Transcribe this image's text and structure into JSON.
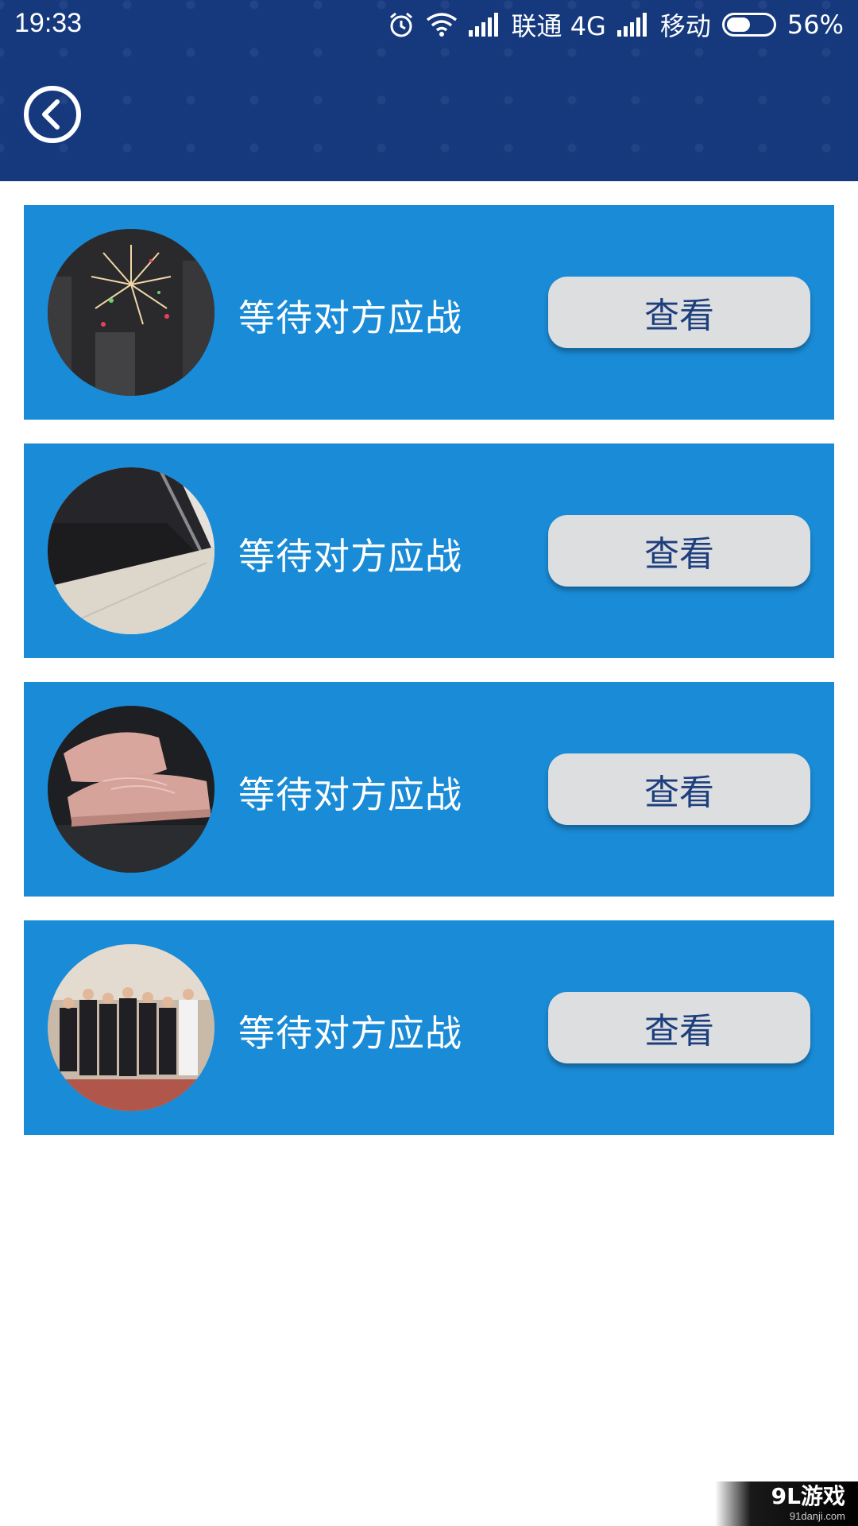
{
  "status_bar": {
    "time": "19:33",
    "carrier1": "联通 4G",
    "carrier2": "移动",
    "battery_percent": "56%",
    "battery_level": 0.56,
    "icons": [
      "alarm-icon",
      "wifi-icon",
      "signal-icon",
      "signal-icon",
      "battery-icon"
    ]
  },
  "header": {
    "back_icon": "back-circle-icon"
  },
  "challenges": [
    {
      "image": "fireworks-photo",
      "status": "等待对方应战",
      "button": "查看"
    },
    {
      "image": "chair-photo",
      "status": "等待对方应战",
      "button": "查看"
    },
    {
      "image": "sneakers-photo",
      "status": "等待对方应战",
      "button": "查看"
    },
    {
      "image": "group-photo",
      "status": "等待对方应战",
      "button": "查看"
    }
  ],
  "watermark": {
    "main": "9L游戏",
    "sub": "91danji.com"
  },
  "colors": {
    "header_bg": "#16397e",
    "card_bg": "#1a8bd6",
    "button_bg": "#dcdedf",
    "button_text": "#1e3f7e"
  }
}
